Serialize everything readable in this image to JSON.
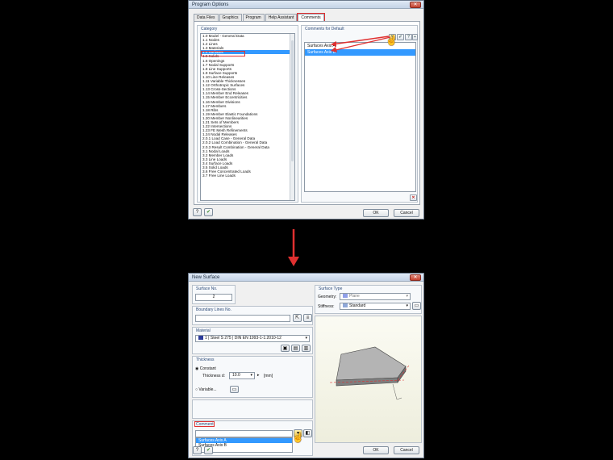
{
  "program_options": {
    "title": "Program Options",
    "tabs": [
      "Data Files",
      "Graphics",
      "Program",
      "Help Assistant",
      "Comments"
    ],
    "category": {
      "title": "Category",
      "items": [
        "1.0 Model - General Data",
        "1.1 Nodes",
        "1.2 Lines",
        "1.3 Materials",
        "1.4 Surfaces",
        "1.5 Solids",
        "1.6 Openings",
        "1.7 Nodal Supports",
        "1.8 Line Supports",
        "1.9 Surface Supports",
        "1.10 Line Releases",
        "1.11 Variable Thicknesses",
        "1.12 Orthotropic Surfaces",
        "1.13 Cross-Sections",
        "1.14 Member End Releases",
        "1.15 Member Eccentricities",
        "1.16 Member Divisions",
        "1.17 Members",
        "1.18 Ribs",
        "1.19 Member Elastic Foundations",
        "1.20 Member Nonlinearities",
        "1.21 Sets of Members",
        "1.22 Intersections",
        "1.23 FE Mesh Refinements",
        "1.24 Nodal Releases",
        "2.0.1 Load Case - General Data",
        "2.0.2 Load Combination - General Data",
        "2.0.3 Result Combination - General Data",
        "3.1 Nodal Loads",
        "3.2 Member Loads",
        "3.3 Line Loads",
        "3.4 Surface Loads",
        "3.5 Solid Loads",
        "3.6 Free Concentrated Loads",
        "3.7 Free Line Loads"
      ],
      "selected": 4
    },
    "comments": {
      "title": "Comments for Default",
      "items": [
        "Surfaces Axis A",
        "Surfaces Axis B"
      ],
      "selected": 1
    },
    "buttons": {
      "ok": "OK",
      "cancel": "Cancel"
    }
  },
  "new_surface": {
    "title": "New Surface",
    "surface_no": {
      "label": "Surface No.",
      "value": "2"
    },
    "boundary_lines": {
      "label": "Boundary Lines No."
    },
    "material": {
      "label": "Material",
      "value": "1 | Steel S 275 | DIN EN 1993-1-1:2010-12"
    },
    "thickness": {
      "label": "Thickness",
      "constant_label": "Constant",
      "thickness_label": "Thickness d:",
      "value": "10.0",
      "unit": "[mm]",
      "variable_label": "Variable..."
    },
    "surface_type": {
      "label": "Surface Type",
      "geometry_label": "Geometry:",
      "geometry_value": "Plane",
      "stiffness_label": "Stiffness:",
      "stiffness_value": "Standard"
    },
    "comment": {
      "label": "Comment",
      "options": [
        "Surfaces Axis A",
        "Surfaces Axis B"
      ],
      "selected": 0
    },
    "buttons": {
      "ok": "OK",
      "cancel": "Cancel"
    }
  },
  "colors": {
    "selection": "#3399ff",
    "highlight": "#e03030",
    "material_swatch": "#2b3a9a",
    "geometry_swatch": "#8f9fe8",
    "stiffness_swatch": "#8fa8d8"
  }
}
